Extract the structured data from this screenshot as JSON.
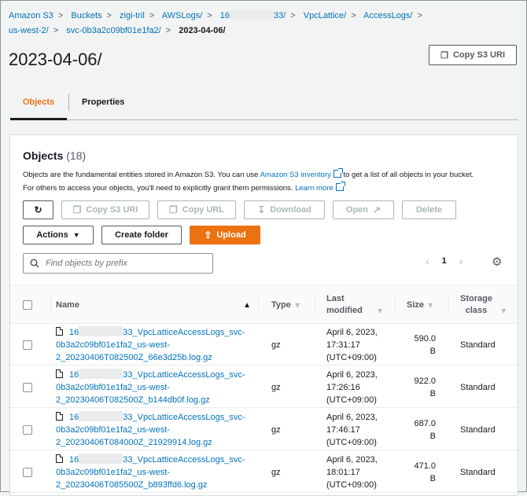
{
  "breadcrumbs": [
    {
      "label": "Amazon S3"
    },
    {
      "label": "Buckets"
    },
    {
      "label": "zigi-tril"
    },
    {
      "label": "AWSLogs/"
    },
    {
      "label_prefix": "16",
      "label_suffix": "33/"
    },
    {
      "label": "VpcLattice/"
    },
    {
      "label": "AccessLogs/"
    },
    {
      "label": "us-west-2/"
    },
    {
      "label": "svc-0b3a2c09bf01e1fa2/"
    },
    {
      "label": "2023-04-06/"
    }
  ],
  "page": {
    "title": "2023-04-06/",
    "copy_uri_label": "Copy S3 URI"
  },
  "tabs": [
    {
      "label": "Objects",
      "active": true
    },
    {
      "label": "Properties",
      "active": false
    }
  ],
  "objects": {
    "title": "Objects",
    "count": "(18)",
    "desc_1": "Objects are the fundamental entities stored in Amazon S3. You can use ",
    "desc_link_1": "Amazon S3 inventory",
    "desc_2": " to get a list of all objects in your bucket.",
    "desc_3": "For others to access your objects, you'll need to explicitly grant them permissions. ",
    "desc_link_2": "Learn more",
    "buttons": {
      "copy_s3_uri": "Copy S3 URI",
      "copy_url": "Copy URL",
      "download": "Download",
      "open": "Open",
      "delete": "Delete",
      "actions": "Actions",
      "create_folder": "Create folder",
      "upload": "Upload"
    },
    "search_placeholder": "Find objects by prefix",
    "page_number": "1"
  },
  "table": {
    "columns": {
      "name": "Name",
      "type": "Type",
      "last_modified_1": "Last",
      "last_modified_2": "modified",
      "size": "Size",
      "storage_class_1": "Storage",
      "storage_class_2": "class"
    },
    "rows": [
      {
        "name_prefix": "16",
        "name_l1": "33_VpcLatticeAccessLogs_svc-",
        "name_l2": "0b3a2c09bf01e1fa2_us-west-",
        "name_l3": "2_20230406T082500Z_66e3d25b.log.gz",
        "type": "gz",
        "modified_1": "April 6, 2023,",
        "modified_2": "17:31:17",
        "modified_3": "(UTC+09:00)",
        "size_1": "590.0",
        "size_2": "B",
        "storage": "Standard"
      },
      {
        "name_prefix": "16",
        "name_l1": "33_VpcLatticeAccessLogs_svc-",
        "name_l2": "0b3a2c09bf01e1fa2_us-west-",
        "name_l3": "2_20230406T082500Z_b144db0f.log.gz",
        "type": "gz",
        "modified_1": "April 6, 2023,",
        "modified_2": "17:26:16",
        "modified_3": "(UTC+09:00)",
        "size_1": "922.0",
        "size_2": "B",
        "storage": "Standard"
      },
      {
        "name_prefix": "16",
        "name_l1": "33_VpcLatticeAccessLogs_svc-",
        "name_l2": "0b3a2c09bf01e1fa2_us-west-",
        "name_l3": "2_20230406T084000Z_21929914.log.gz",
        "type": "gz",
        "modified_1": "April 6, 2023,",
        "modified_2": "17:46:17",
        "modified_3": "(UTC+09:00)",
        "size_1": "687.0",
        "size_2": "B",
        "storage": "Standard"
      },
      {
        "name_prefix": "16",
        "name_l1": "33_VpcLatticeAccessLogs_svc-",
        "name_l2": "0b3a2c09bf01e1fa2_us-west-",
        "name_l3": "2_20230406T085500Z_b893ffd6.log.gz",
        "type": "gz",
        "modified_1": "April 6, 2023,",
        "modified_2": "18:01:17",
        "modified_3": "(UTC+09:00)",
        "size_1": "471.0",
        "size_2": "B",
        "storage": "Standard"
      }
    ]
  },
  "colors": {
    "link": "#0073bb",
    "accent": "#ec7211",
    "disabled": "#aab7b8"
  }
}
